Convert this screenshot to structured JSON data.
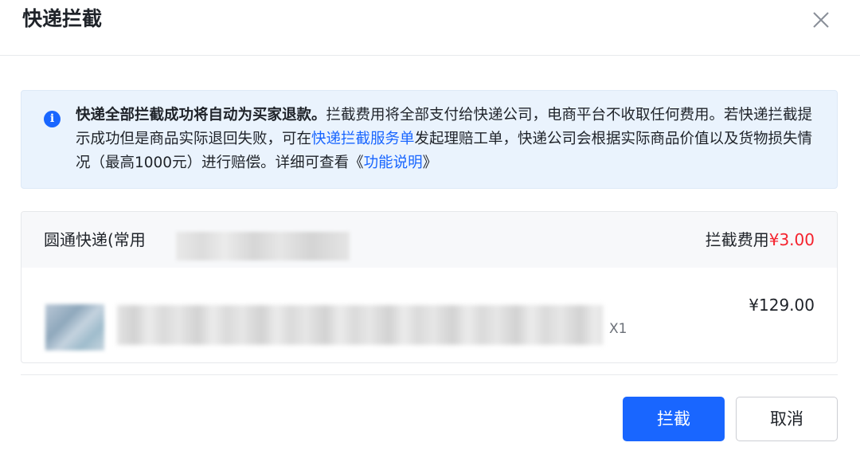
{
  "dialog": {
    "title": "快递拦截"
  },
  "notice": {
    "icon": "info-icon",
    "bold_text": "快递全部拦截成功将自动为买家退款。",
    "text_1": "拦截费用将全部支付给快递公司，电商平台不收取任何费用。若快递拦截提示成功但是商品实际退回失败，可在",
    "link_service": "快递拦截服务单",
    "text_2": "发起理赔工单，快递公司会根据实际商品价值以及货物损失情况（最高1000元）进行赔偿。详细可查看《",
    "link_doc": "功能说明",
    "text_3": "》"
  },
  "shipment": {
    "carrier": "圆通快递(常用",
    "fee_label": "拦截费用",
    "fee_amount": "¥3.00",
    "item": {
      "quantity": "X1",
      "price": "¥129.00"
    }
  },
  "actions": {
    "intercept_label": "拦截",
    "cancel_label": "取消"
  },
  "colors": {
    "primary": "#1966ff",
    "danger": "#f5222d",
    "notice_bg": "#eaf3fd"
  }
}
